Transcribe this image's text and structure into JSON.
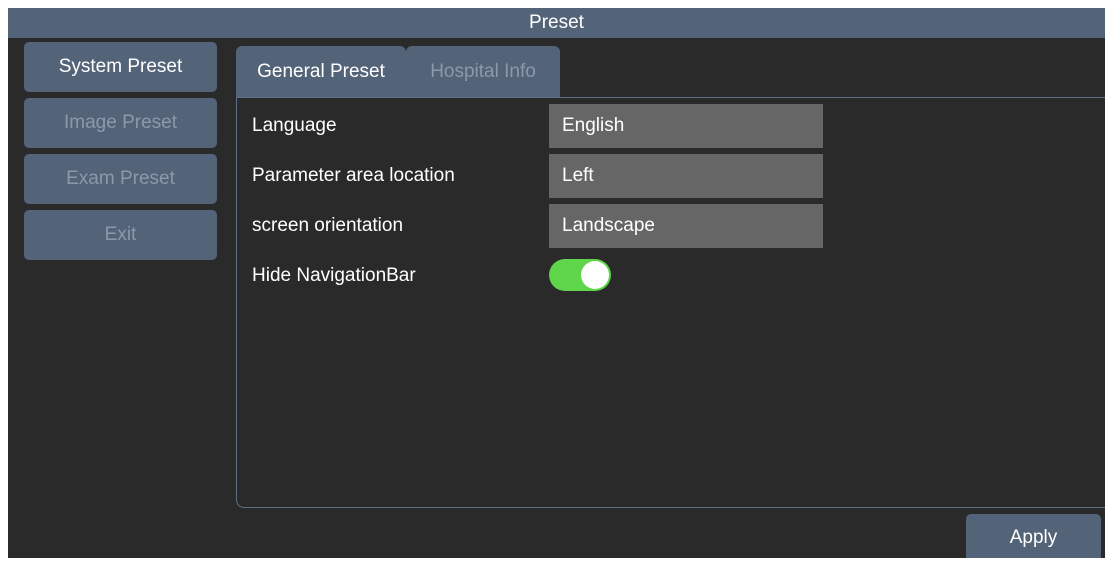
{
  "title": "Preset",
  "sidebar": {
    "items": [
      {
        "label": "System Preset",
        "active": true
      },
      {
        "label": "Image Preset",
        "active": false
      },
      {
        "label": "Exam Preset",
        "active": false
      },
      {
        "label": "Exit",
        "active": false
      }
    ]
  },
  "tabs": [
    {
      "label": "General Preset",
      "active": true
    },
    {
      "label": "Hospital Info",
      "active": false
    }
  ],
  "settings": {
    "language": {
      "label": "Language",
      "value": "English"
    },
    "parameter_area": {
      "label": "Parameter area location",
      "value": "Left"
    },
    "orientation": {
      "label": "screen orientation",
      "value": "Landscape"
    },
    "hide_navbar": {
      "label": "Hide NavigationBar",
      "enabled": true
    }
  },
  "apply_label": "Apply",
  "colors": {
    "accent": "#536378",
    "toggle_on": "#5fd54a",
    "background": "#2a2a2b"
  },
  "icons": {
    "toggle": "toggle-switch-icon"
  }
}
